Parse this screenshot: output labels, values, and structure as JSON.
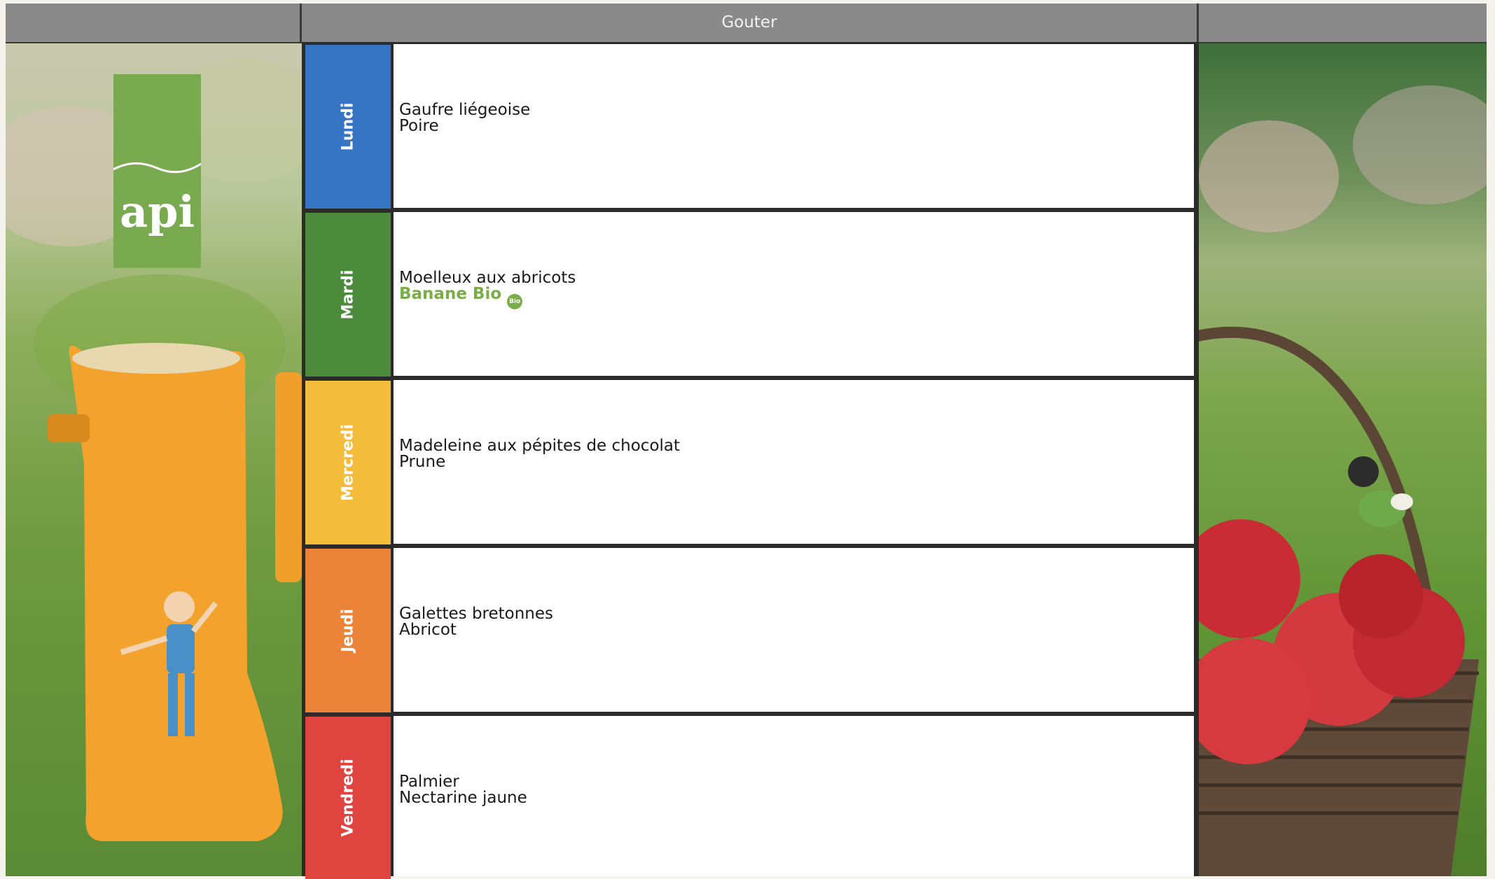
{
  "header": {
    "title": "Gouter"
  },
  "logo": {
    "text": "api"
  },
  "days": [
    {
      "label": "Lundi",
      "color": "#3575c4",
      "items": [
        {
          "text": "Gaufre liégeoise"
        },
        {
          "text": "Poire"
        }
      ]
    },
    {
      "label": "Mardi",
      "color": "#4c8b3c",
      "items": [
        {
          "text": "Moelleux aux abricots"
        },
        {
          "text": "Banane Bio",
          "bio": true,
          "badge": "Bio"
        }
      ]
    },
    {
      "label": "Mercredi",
      "color": "#f3bc3a",
      "items": [
        {
          "text": "Madeleine aux pépites de chocolat"
        },
        {
          "text": "Prune"
        }
      ]
    },
    {
      "label": "Jeudi",
      "color": "#eb8439",
      "items": [
        {
          "text": "Galettes bretonnes"
        },
        {
          "text": "Abricot"
        }
      ]
    },
    {
      "label": "Vendredi",
      "color": "#e0443f",
      "items": [
        {
          "text": "Palmier"
        },
        {
          "text": "Nectarine jaune"
        }
      ]
    }
  ]
}
